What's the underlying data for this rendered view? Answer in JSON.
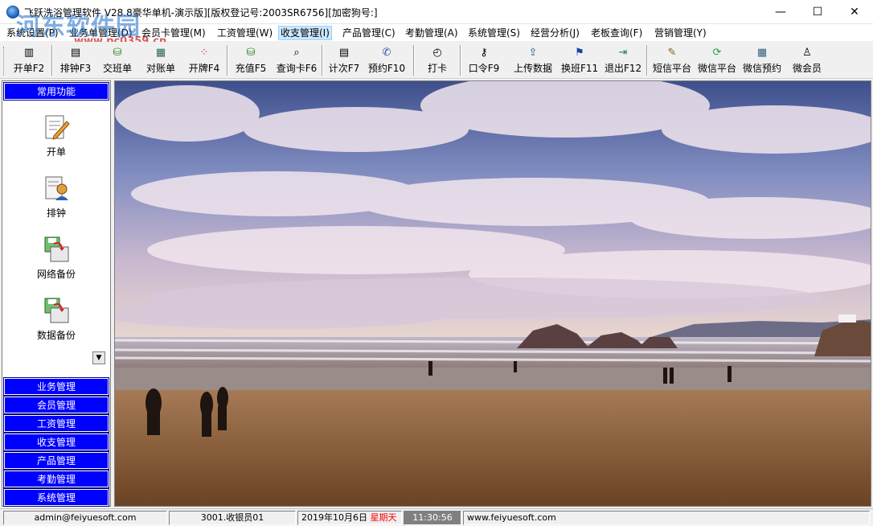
{
  "window": {
    "title": "飞跃洗浴管理软件 V28.8豪华单机-演示版][版权登记号:2003SR6756][加密狗号:]",
    "minimize": "—",
    "maximize": "☐",
    "close": "✕"
  },
  "watermark": {
    "main": "河东软件园",
    "url": "www.pc0359.cn"
  },
  "menu": [
    {
      "label": "系统设置(P)"
    },
    {
      "label": "业务单管理(D)"
    },
    {
      "label": "会员卡管理(M)"
    },
    {
      "label": "工资管理(W)"
    },
    {
      "label": "收支管理(I)"
    },
    {
      "label": "产品管理(C)"
    },
    {
      "label": "考勤管理(A)"
    },
    {
      "label": "系统管理(S)"
    },
    {
      "label": "经营分析(J)"
    },
    {
      "label": "老板查询(F)"
    },
    {
      "label": "营销管理(Y)"
    }
  ],
  "toolbar": [
    {
      "label": "开单F2",
      "icon": "▥"
    },
    {
      "label": "排钟F3",
      "icon": "▤"
    },
    {
      "label": "交班单",
      "icon": "⛁"
    },
    {
      "label": "对账单",
      "icon": "▦"
    },
    {
      "label": "开牌F4",
      "icon": "⁘"
    },
    {
      "label": "充值F5",
      "icon": "⛁"
    },
    {
      "label": "查询卡F6",
      "icon": "⌕"
    },
    {
      "label": "计次F7",
      "icon": "▤"
    },
    {
      "label": "预约F10",
      "icon": "✆"
    },
    {
      "label": "打卡",
      "icon": "◴"
    },
    {
      "label": "口令F9",
      "icon": "⚷"
    },
    {
      "label": "上传数据",
      "icon": "⇪"
    },
    {
      "label": "换班F11",
      "icon": "⚑"
    },
    {
      "label": "退出F12",
      "icon": "⇥"
    },
    {
      "label": "短信平台",
      "icon": "✎"
    },
    {
      "label": "微信平台",
      "icon": "⟳"
    },
    {
      "label": "微信预约",
      "icon": "▦"
    },
    {
      "label": "微会员",
      "icon": "♙"
    }
  ],
  "sidebar": {
    "top_header": "常用功能",
    "items": [
      {
        "label": "开单"
      },
      {
        "label": "排钟"
      },
      {
        "label": "网络备份"
      },
      {
        "label": "数据备份"
      }
    ],
    "scroll_glyph": "▼",
    "sections": [
      {
        "label": "业务管理"
      },
      {
        "label": "会员管理"
      },
      {
        "label": "工资管理"
      },
      {
        "label": "收支管理"
      },
      {
        "label": "产品管理"
      },
      {
        "label": "考勤管理"
      },
      {
        "label": "系统管理"
      }
    ]
  },
  "status": {
    "user": "admin@feiyuesoft.com",
    "cashier": "3001.收银员01",
    "date": "2019年10月6日",
    "weekday": "星期天",
    "time": "11:30:56",
    "website": "www.feiyuesoft.com"
  },
  "colors": {
    "side_header_bg": "#0000ff",
    "weekday_text": "#ff0000",
    "time_bg": "#808080",
    "menu_active_bg": "#cce8ff"
  }
}
